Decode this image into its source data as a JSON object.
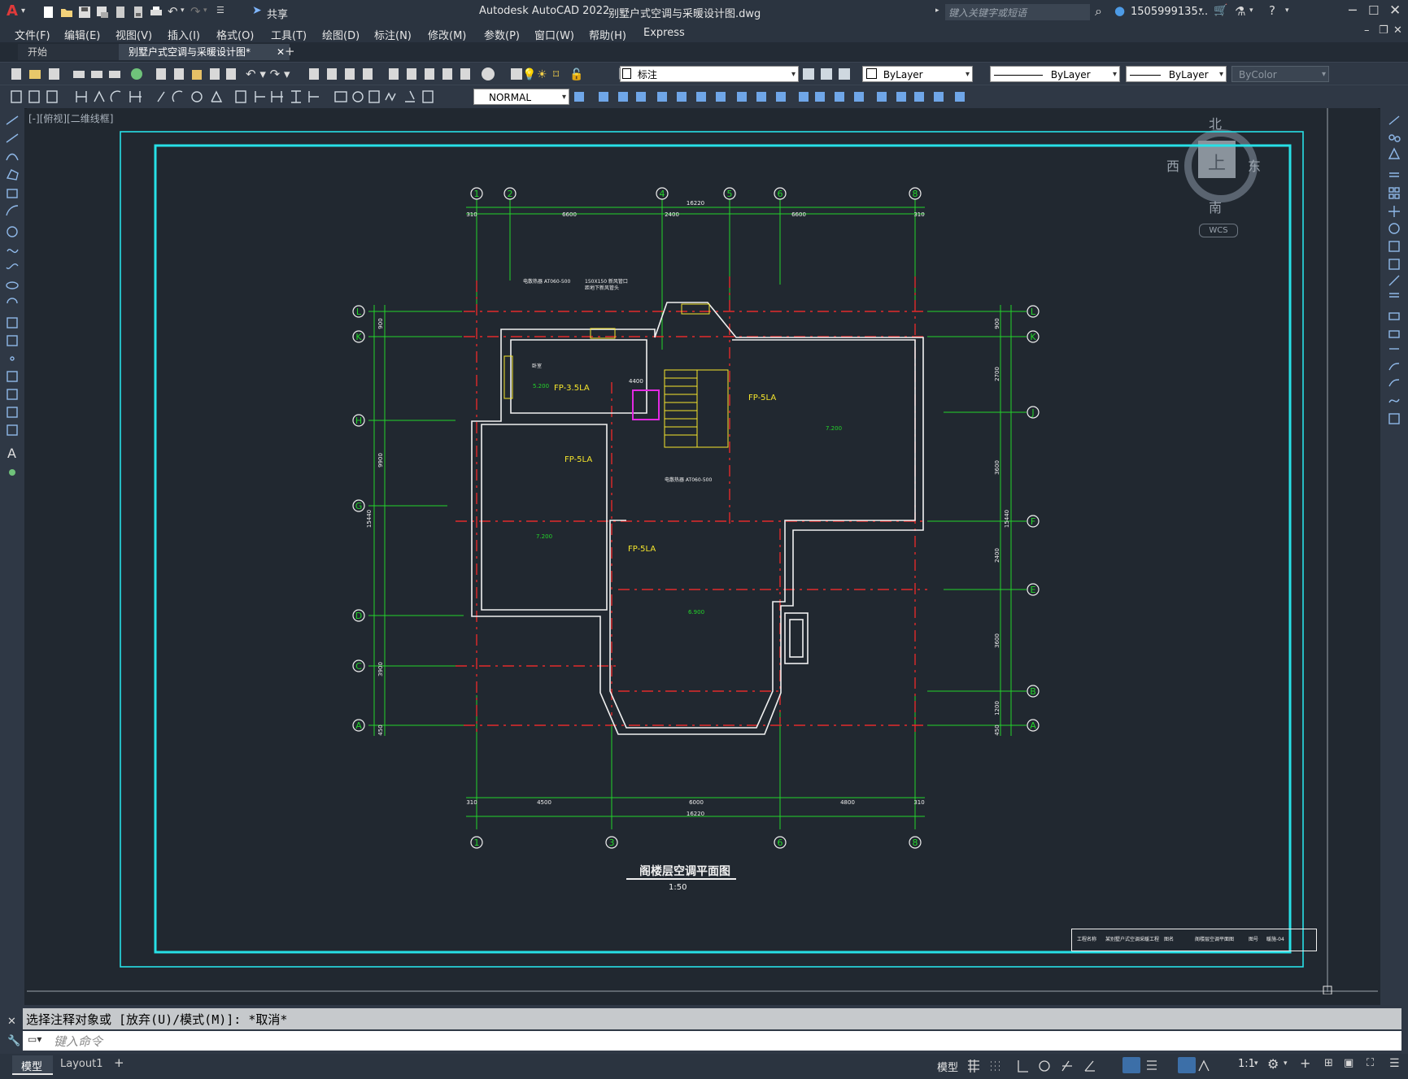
{
  "app": {
    "title": "Autodesk AutoCAD 2022",
    "file_name": "别墅户式空调与采暖设计图.dwg",
    "share_label": "共享",
    "search_placeholder": "键入关键字或短语",
    "user": "1505999135...",
    "accent": "#e03a3a"
  },
  "menu": [
    "文件(F)",
    "编辑(E)",
    "视图(V)",
    "插入(I)",
    "格式(O)",
    "工具(T)",
    "绘图(D)",
    "标注(N)",
    "修改(M)",
    "参数(P)",
    "窗口(W)",
    "帮助(H)",
    "Express"
  ],
  "tabs": [
    {
      "label": "开始",
      "active": false
    },
    {
      "label": "别墅户式空调与采暖设计图*",
      "active": true
    }
  ],
  "toolbar": {
    "layer_value": "标注",
    "color_value": "ByLayer",
    "linetype_value": "ByLayer",
    "lineweight_value": "ByLayer",
    "plotstyle_value": "ByColor",
    "textstyle_value": "NORMAL"
  },
  "viewport_label": "[-][俯视][二维线框]",
  "viewcube": {
    "north": "北",
    "south": "南",
    "east": "东",
    "west": "西",
    "top": "上",
    "wcs": "WCS"
  },
  "drawing": {
    "title": "阁楼层空调平面图",
    "scale": "1:50",
    "top_axes": [
      "1",
      "2",
      "4",
      "5",
      "6",
      "8"
    ],
    "bottom_axes": [
      "1",
      "3",
      "6",
      "8"
    ],
    "left_axes": [
      "L",
      "K",
      "H",
      "G",
      "D",
      "C",
      "A"
    ],
    "right_axes": [
      "L",
      "K",
      "J",
      "F",
      "E",
      "B",
      "A"
    ],
    "top_total_dim": "16220",
    "top_dims": [
      "310",
      "6600",
      "2400",
      "6600",
      "310"
    ],
    "bottom_total_dim": "16220",
    "bottom_dims": [
      "310",
      "4500",
      "6000",
      "4800",
      "310"
    ],
    "left_dims": [
      "900",
      "9900",
      "3900",
      "450"
    ],
    "left_total_dim": "15440",
    "right_dims": [
      "900",
      "2700",
      "3600",
      "2400",
      "3600",
      "1200",
      "450"
    ],
    "right_total_dim": "15440",
    "units": [
      "FP-3.5LA",
      "FP-5LA",
      "FP-5LA",
      "FP-5LA"
    ],
    "elevations": [
      "5.200",
      "7.200",
      "7.200",
      "6.900",
      "4400"
    ],
    "notes": [
      "电散热器 AT060-500",
      "150X150 新风管口 距地下新风管头",
      "电散热器 AT060-500",
      "卧室"
    ],
    "title_block": [
      "工程名称",
      "某别墅户式空调采暖工程",
      "图名",
      "阁楼层空调平面图",
      "图号",
      "暖施-04"
    ]
  },
  "command": {
    "history": "选择注释对象或 [放弃(U)/模式(M)]: *取消*",
    "placeholder": "键入命令"
  },
  "layout_tabs": [
    "模型",
    "Layout1"
  ],
  "status": {
    "model": "模型",
    "scale": "1:1"
  }
}
